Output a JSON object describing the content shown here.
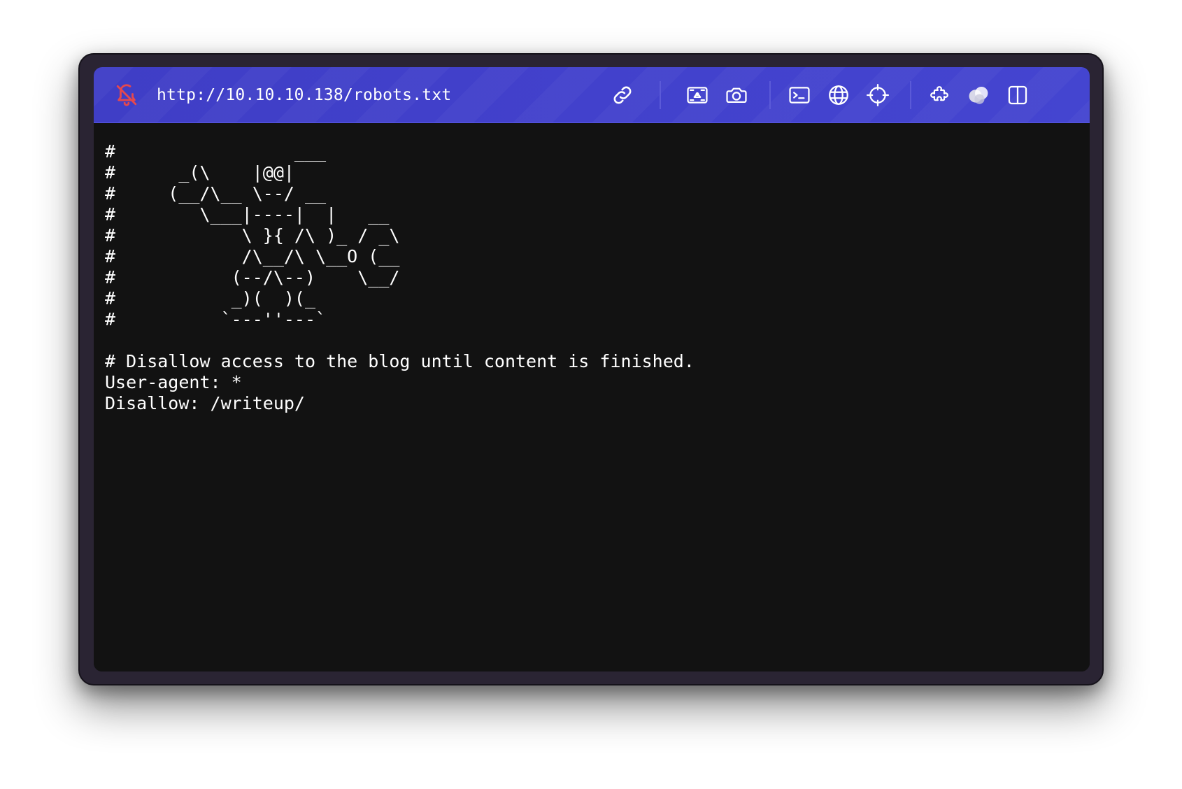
{
  "toolbar": {
    "url": "http://10.10.10.138/robots.txt",
    "icons": [
      "bell-off-icon",
      "link-icon",
      "screenshot-area-icon",
      "camera-icon",
      "terminal-icon",
      "globe-icon",
      "crosshair-icon",
      "puzzle-icon",
      "color-circles-icon",
      "split-view-icon"
    ],
    "accent_color": "#4241cc",
    "alert_icon_color": "#e5484d"
  },
  "document": {
    "text": "#                 ___\n#      _(\\    |@@|\n#     (__/\\__ \\--/ __\n#        \\___|----|  |   __\n#            \\ }{ /\\ )_ / _\\\n#            /\\__/\\ \\__O (__\n#           (--/\\--)    \\__/\n#           _)(  )(_\n#          `---''---`\n\n# Disallow access to the blog until content is finished.\nUser-agent: *\nDisallow: /writeup/"
  }
}
